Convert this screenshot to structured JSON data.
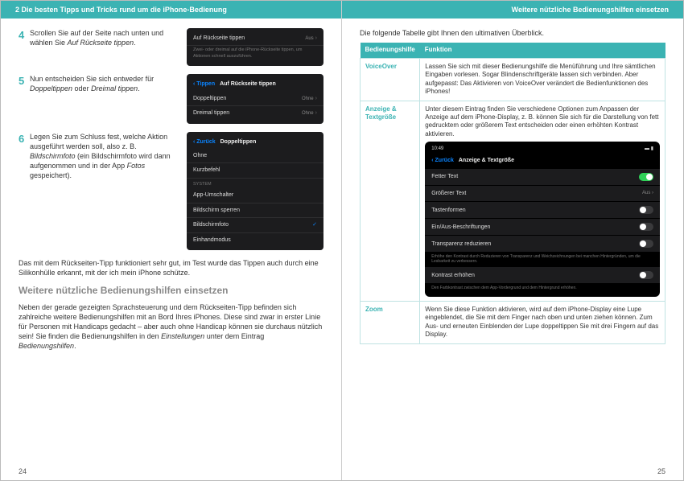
{
  "header_left": "2   Die besten Tipps und Tricks rund um die iPhone-Bedienung",
  "header_right": "Weitere nützliche Bedienungshilfen einsetzen",
  "steps": [
    {
      "num": "4",
      "text_a": "Scrollen Sie auf der Seite nach unten und wählen Sie ",
      "text_i": "Auf Rückseite tippen",
      "text_b": "."
    },
    {
      "num": "5",
      "text_a": "Nun entscheiden Sie sich entweder für ",
      "text_i": "Doppeltippen",
      "text_b": " oder ",
      "text_i2": "Dreimal tippen",
      "text_c": "."
    },
    {
      "num": "6",
      "text_a": "Legen Sie zum Schluss fest, welche Aktion ausgeführt werden soll, also z. B. ",
      "text_i": "Bildschirmfoto",
      "text_b": " (ein Bildschirmfoto wird dann aufgenommen und in der App ",
      "text_i2": "Fotos",
      "text_c": " gespeichert)."
    }
  ],
  "phone4": {
    "row1": "Auf Rückseite tippen",
    "row1_val": "Aus",
    "sub": "Zwei- oder dreimal auf die iPhone-Rückseite tippen, um Aktionen schnell auszuführen."
  },
  "phone5": {
    "back": "Tippen",
    "title": "Auf Rückseite tippen",
    "row1": "Doppeltippen",
    "row1_val": "Ohne",
    "row2": "Dreimal tippen",
    "row2_val": "Ohne"
  },
  "phone6": {
    "back": "Zurück",
    "title": "Doppeltippen",
    "row1": "Ohne",
    "row2": "Kurzbefehl",
    "label": "System",
    "sys1": "App-Umschalter",
    "sys2": "Bildschirm sperren",
    "sys3": "Bildschirmfoto",
    "sys4": "Einhandmodus"
  },
  "para1": "Das mit dem Rückseiten-Tipp funktioniert sehr gut, im Test wurde das Tippen auch durch eine Silikonhülle erkannt, mit der ich mein iPhone schütze.",
  "h2": "Weitere nützliche Bedienungshilfen einsetzen",
  "para2_a": "Neben der gerade gezeigten Sprachsteuerung und dem Rückseiten-Tipp befinden sich zahlreiche weitere Bedienungshilfen mit an Bord Ihres iPhones. Diese sind zwar in erster Linie für Personen mit Handicaps gedacht – aber auch ohne Handicap können sie durchaus nützlich sein! Sie finden die Bedienungshilfen in den ",
  "para2_i1": "Einstellungen",
  "para2_b": " unter dem Eintrag ",
  "para2_i2": "Bedienungshilfen",
  "para2_c": ".",
  "pagenum_left": "24",
  "intro_right": "Die folgende Tabelle gibt Ihnen den ultimativen Überblick.",
  "th1": "Bedienungshilfe",
  "th2": "Funktion",
  "row_voiceover": {
    "name": "VoiceOver",
    "desc": "Lassen Sie sich mit dieser Bedienungshilfe die Menüführung und Ihre sämtlichen Eingaben vorlesen. Sogar Blindenschriftgeräte lassen sich verbinden. Aber aufgepasst: Das Aktivieren von VoiceOver verändert die Bedienfunktionen des iPhones!"
  },
  "row_anzeige": {
    "name": "Anzeige & Textgröße",
    "desc": "Unter diesem Eintrag finden Sie verschiedene Optionen zum Anpassen der Anzeige auf dem iPhone-Display, z. B. können Sie sich für die Darstellung von fett gedrucktem oder größerem Text entscheiden oder einen erhöhten Kontrast aktivieren."
  },
  "row_zoom": {
    "name": "Zoom",
    "desc": "Wenn Sie diese Funktion aktivieren, wird auf dem iPhone-Display eine Lupe eingeblendet, die Sie mit dem Finger nach oben und unten ziehen können. Zum Aus- und erneuten Einblenden der Lupe doppeltippen Sie mit drei Fingern auf das Display."
  },
  "phone_anzeige": {
    "time": "10:49",
    "signal": "▬ ▮",
    "back": "Zurück",
    "title": "Anzeige & Textgröße",
    "r1": "Fetter Text",
    "r2": "Größerer Text",
    "r2_val": "Aus",
    "r3": "Tastenformen",
    "r4": "Ein/Aus-Beschriftungen",
    "r5": "Transparenz reduzieren",
    "note1": "Erhöhe den Kontrast durch Reduzieren von Transparenz und Weichzeichnungen bei manchen Hintergründen, um die Lesbarkeit zu verbessern.",
    "r6": "Kontrast erhöhen",
    "note2": "Den Farbkontrast zwischen dem App-Vordergrund und dem Hintergrund erhöhen."
  },
  "pagenum_right": "25"
}
